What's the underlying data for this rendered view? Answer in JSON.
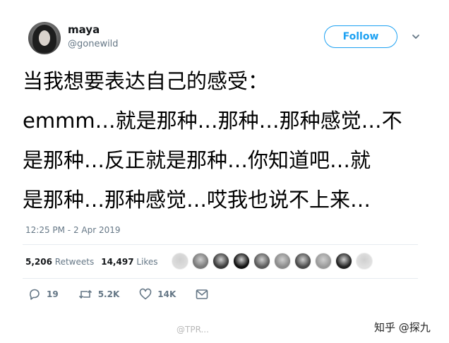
{
  "user": {
    "name": "maya",
    "handle": "@gonewild"
  },
  "header": {
    "follow_label": "Follow"
  },
  "tweet": {
    "lines": [
      "当我想要表达自己的感受：",
      "emmm…就是那种…那种…那种感觉…不",
      "是那种…反正就是那种…你知道吧…就",
      "是那种…那种感觉…哎我也说不上来…"
    ],
    "timestamp": "12:25 PM - 2 Apr 2019"
  },
  "stats": {
    "retweets_count": "5,206",
    "retweets_label": "Retweets",
    "likes_count": "14,497",
    "likes_label": "Likes"
  },
  "likers": {
    "count": 10,
    "colors": [
      "#dcdcdc",
      "#7a7a7a",
      "#3a3a3a",
      "#111111",
      "#5a5a5a",
      "#8a8a8a",
      "#4a4a4a",
      "#9a9a9a",
      "#222222",
      "#e0e0e0"
    ]
  },
  "actions": {
    "reply_count": "19",
    "retweet_count": "5.2K",
    "like_count": "14K"
  },
  "watermarks": {
    "zhihu": "知乎 @探九",
    "weibo": "@TPR..."
  },
  "icons": {
    "reply": "reply-icon",
    "retweet": "retweet-icon",
    "like": "heart-icon",
    "dm": "message-icon",
    "more": "chevron-down-icon"
  },
  "colors": {
    "accent": "#1da1f2",
    "muted": "#657786",
    "divider": "#e6ecf0"
  }
}
